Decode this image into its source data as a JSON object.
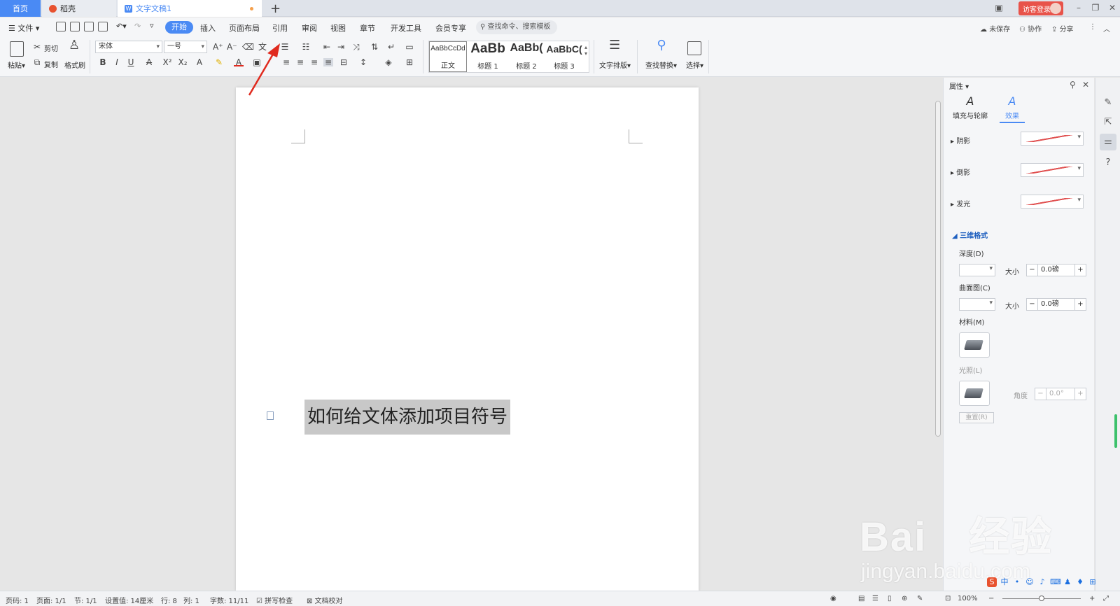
{
  "tabs": {
    "home": "首页",
    "daoke": "稻壳",
    "doc": "文字文稿1"
  },
  "titlebar": {
    "login": "访客登录"
  },
  "menu": {
    "file": "文件",
    "items": [
      "开始",
      "插入",
      "页面布局",
      "引用",
      "审阅",
      "视图",
      "章节",
      "开发工具",
      "会员专享"
    ],
    "search_placeholder": "查找命令、搜索模板",
    "unsaved": "未保存",
    "collab": "协作",
    "share": "分享"
  },
  "ribbon": {
    "paste": "粘贴",
    "cut": "剪切",
    "copy": "复制",
    "format_painter": "格式刷",
    "font_name": "宋体",
    "font_size": "一号",
    "styles": [
      {
        "preview": "AaBbCcDd",
        "name": "正文"
      },
      {
        "preview": "AaBb",
        "name": "标题 1"
      },
      {
        "preview": "AaBb(",
        "name": "标题 2"
      },
      {
        "preview": "AaBbC(",
        "name": "标题 3"
      }
    ],
    "text_layout": "文字排版",
    "find_replace": "查找替换",
    "select": "选择"
  },
  "document": {
    "selected_text": "如何给文体添加项目符号"
  },
  "panel": {
    "title": "属性",
    "tab_fill": "填充与轮廓",
    "tab_effect": "效果",
    "shadow": "阴影",
    "reflection": "倒影",
    "glow": "发光",
    "three_d": "三维格式",
    "depth": "深度(D)",
    "size": "大小",
    "depth_value": "0.0磅",
    "contour": "曲面图(C)",
    "contour_value": "0.0磅",
    "material": "材料(M)",
    "lighting": "光照(L)",
    "angle": "角度",
    "angle_value": "0.0°",
    "reset": "重置(R)"
  },
  "status": {
    "page_num": "页码: 1",
    "pages": "页面: 1/1",
    "section": "节: 1/1",
    "setting": "设置值: 14厘米",
    "row": "行: 8",
    "col": "列: 1",
    "words": "字数: 11/11",
    "spell": "拼写检查",
    "proof": "文档校对",
    "zoom": "100%"
  },
  "watermark": {
    "brand": "Bai",
    "brand_cn": "经验",
    "url": "jingyan.baidu.com"
  },
  "colors": {
    "accent": "#4a8af4",
    "login": "#e8534a",
    "arrow": "#e02a1e"
  }
}
